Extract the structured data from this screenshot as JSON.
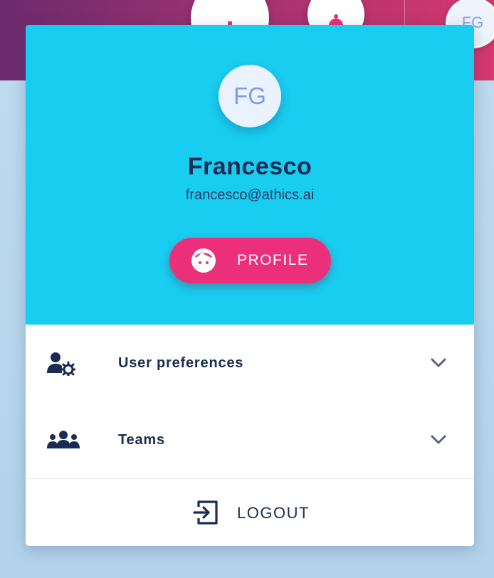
{
  "topbar": {
    "avatar_initials": "FG",
    "icons": [
      "add-icon",
      "bell-icon"
    ]
  },
  "menu": {
    "avatar_initials": "FG",
    "user_name": "Francesco",
    "user_email": "francesco@athics.ai",
    "profile_label": "PROFILE",
    "items": [
      {
        "label": "User preferences",
        "icon": "user-gear-icon"
      },
      {
        "label": "Teams",
        "icon": "team-icon"
      }
    ],
    "logout_label": "LOGOUT"
  },
  "colors": {
    "header_bg": "#18cdf0",
    "accent": "#ec2f7a",
    "text_dark": "#1b2c52",
    "avatar_text": "#7e9bea"
  }
}
